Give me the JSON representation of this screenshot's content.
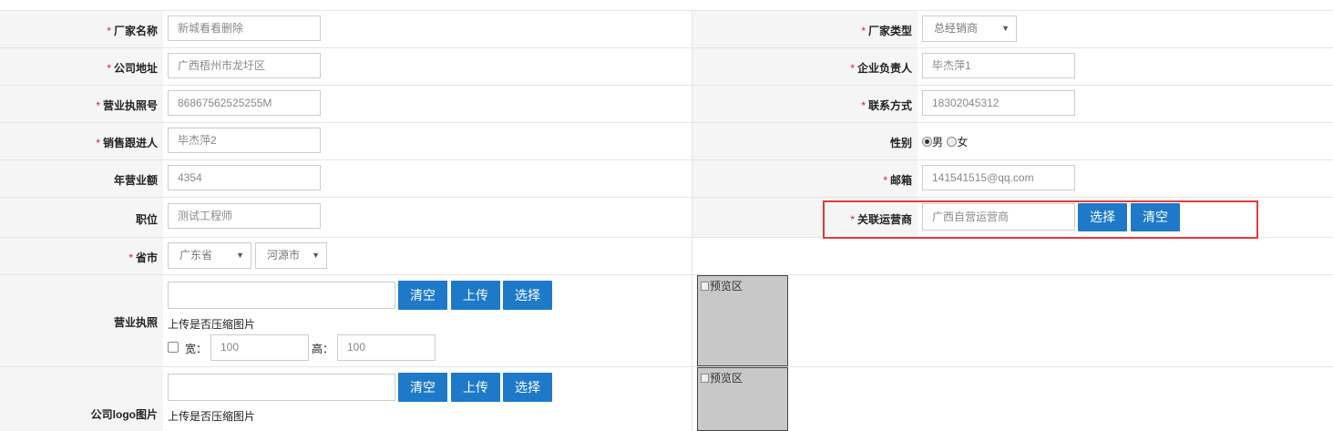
{
  "form": {
    "vendor_name": {
      "label": "厂家名称",
      "required": "*",
      "value": "新城看看删除"
    },
    "vendor_type": {
      "label": "厂家类型",
      "required": "*",
      "value": "总经销商"
    },
    "company_address": {
      "label": "公司地址",
      "required": "*",
      "value": "广西梧州市龙圩区"
    },
    "legal_person": {
      "label": "企业负责人",
      "required": "*",
      "value": "毕杰萍1"
    },
    "license_no": {
      "label": "营业执照号",
      "required": "*",
      "value": "86867562525255M"
    },
    "contact": {
      "label": "联系方式",
      "required": "*",
      "value": "18302045312"
    },
    "sales_follower": {
      "label": "销售跟进人",
      "required": "*",
      "value": "毕杰萍2"
    },
    "gender": {
      "label": "性别",
      "options": [
        "男",
        "女"
      ],
      "selected": "男"
    },
    "annual_revenue": {
      "label": "年营业额",
      "value": "4354"
    },
    "email": {
      "label": "邮箱",
      "required": "*",
      "value": "141541515@qq.com"
    },
    "position": {
      "label": "职位",
      "value": "测试工程师"
    },
    "operator": {
      "label": "关联运营商",
      "required": "*",
      "value": "广西自营运营商",
      "select_label": "选择",
      "clear_label": "清空"
    },
    "province_city": {
      "label": "省市",
      "required": "*",
      "province": "广东省",
      "city": "河源市"
    },
    "business_license": {
      "label": "营业执照",
      "clear_label": "清空",
      "upload_label": "上传",
      "select_label": "选择",
      "compress_text": "上传是否压缩图片",
      "width_label": "宽：",
      "width_value": "100",
      "height_label": "高：",
      "height_value": "100",
      "preview_alt": "预览区"
    },
    "logo": {
      "label": "公司logo图片",
      "clear_label": "清空",
      "upload_label": "上传",
      "select_label": "选择",
      "compress_text": "上传是否压缩图片",
      "preview_alt": "预览区"
    }
  },
  "icons": {
    "dropdown": "▼"
  },
  "colors": {
    "primary_button": "#1e7ac8",
    "required_mark": "#e02020",
    "highlight_box": "#e03a3a",
    "label_bg": "#f5f5f5"
  }
}
